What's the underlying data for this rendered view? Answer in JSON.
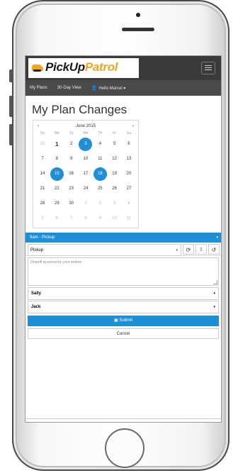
{
  "app": {
    "logo_text_main": "PickUp",
    "logo_text_accent": "Patrol"
  },
  "nav": {
    "items": [
      "My Plans",
      "30-Day View"
    ],
    "user_name": "Hello Marcel",
    "user_caret": "▾"
  },
  "page": {
    "title": "My Plan Changes"
  },
  "calendar": {
    "month_label": "June 2015",
    "prev": "‹",
    "next": "›",
    "weekdays": [
      "Su",
      "Mo",
      "Tu",
      "We",
      "Th",
      "Fr",
      "Sa"
    ],
    "weeks": [
      [
        {
          "d": "31",
          "m": true
        },
        {
          "d": "1",
          "b": true
        },
        {
          "d": "2"
        },
        {
          "d": "3",
          "s": true
        },
        {
          "d": "4"
        },
        {
          "d": "5"
        },
        {
          "d": "6"
        }
      ],
      [
        {
          "d": "7"
        },
        {
          "d": "8"
        },
        {
          "d": "9"
        },
        {
          "d": "10"
        },
        {
          "d": "11"
        },
        {
          "d": "12"
        },
        {
          "d": "13"
        }
      ],
      [
        {
          "d": "14"
        },
        {
          "d": "15",
          "s": true
        },
        {
          "d": "16"
        },
        {
          "d": "17"
        },
        {
          "d": "18",
          "s": true
        },
        {
          "d": "19"
        },
        {
          "d": "20"
        }
      ],
      [
        {
          "d": "21"
        },
        {
          "d": "22"
        },
        {
          "d": "23"
        },
        {
          "d": "24"
        },
        {
          "d": "25"
        },
        {
          "d": "26"
        },
        {
          "d": "27"
        }
      ],
      [
        {
          "d": "28"
        },
        {
          "d": "29"
        },
        {
          "d": "30"
        },
        {
          "d": "1",
          "m": true
        },
        {
          "d": "2",
          "m": true
        },
        {
          "d": "3",
          "m": true
        },
        {
          "d": "4",
          "m": true
        }
      ],
      [
        {
          "d": "5",
          "m": true
        },
        {
          "d": "6",
          "m": true
        },
        {
          "d": "7",
          "m": true
        },
        {
          "d": "8",
          "m": true
        },
        {
          "d": "9",
          "m": true
        },
        {
          "d": "10",
          "m": true
        },
        {
          "d": "11",
          "m": true
        }
      ]
    ]
  },
  "form": {
    "section_label": "9am - Pickup",
    "section_caret": "▾",
    "type_value": "Pickup",
    "type_caret": "▾",
    "icon_refresh": "⟳",
    "icon_delete": "🗑",
    "icon_undo": "↺",
    "note_text": "Dropoff at school by your mother",
    "children": [
      "Sally",
      "Jack"
    ],
    "child_caret": "▾",
    "submit_label": "Submit",
    "submit_icon": "💾",
    "cancel_label": "Cancel"
  },
  "colors": {
    "accent": "#1e8fd6",
    "brand": "#f0a71f",
    "header": "#3a3a3a"
  }
}
